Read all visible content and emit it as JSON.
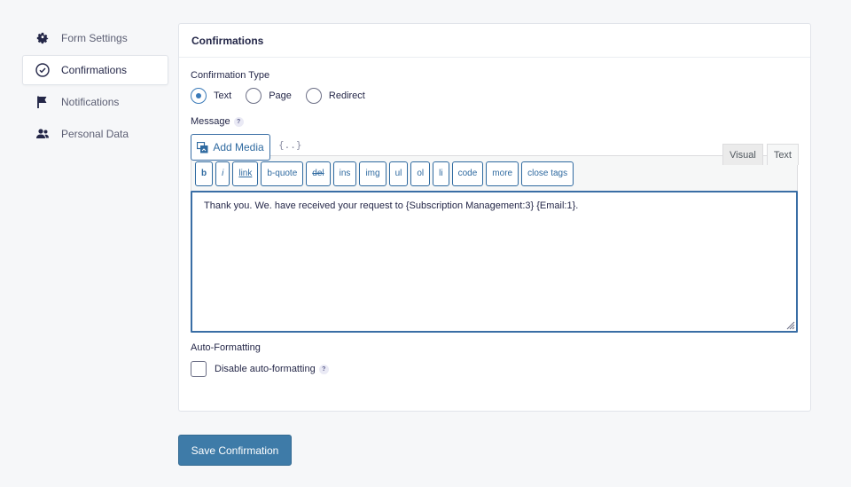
{
  "sidebar": {
    "items": [
      {
        "label": "Form Settings",
        "icon": "gear-icon"
      },
      {
        "label": "Confirmations",
        "icon": "check-circle-icon",
        "active": true
      },
      {
        "label": "Notifications",
        "icon": "flag-icon"
      },
      {
        "label": "Personal Data",
        "icon": "users-icon"
      }
    ]
  },
  "panel": {
    "title": "Confirmations",
    "confirmation_type": {
      "label": "Confirmation Type",
      "options": [
        "Text",
        "Page",
        "Redirect"
      ],
      "selected": "Text"
    },
    "message": {
      "label": "Message",
      "help": "?",
      "add_media_label": "Add Media",
      "merge_tag_label": "{..}",
      "tabs": [
        "Visual",
        "Text"
      ],
      "active_tab": "Text",
      "toolbar": [
        "b",
        "i",
        "link",
        "b-quote",
        "del",
        "ins",
        "img",
        "ul",
        "ol",
        "li",
        "code",
        "more",
        "close tags"
      ],
      "content": "Thank you. We. have received your request to {Subscription Management:3} {Email:1}."
    },
    "auto_formatting": {
      "label": "Auto-Formatting",
      "checkbox_label": "Disable auto-formatting",
      "help": "?",
      "checked": false
    }
  },
  "save_button_label": "Save Confirmation",
  "colors": {
    "accent": "#3e7ba8",
    "link": "#2f6aa0",
    "background": "#f6f7f9"
  }
}
